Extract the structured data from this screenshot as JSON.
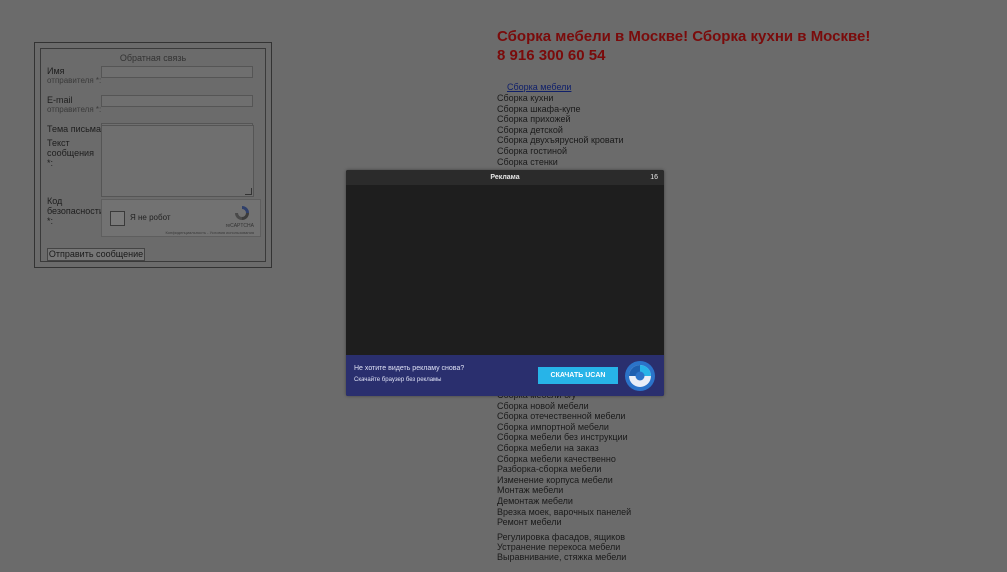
{
  "form": {
    "legend": "Обратная связь",
    "name_label": "Имя",
    "name_req": "отправителя *:",
    "email_label": "E-mail",
    "email_req": "отправителя *:",
    "subject_label": "Тема письма:",
    "message_label": "Текст сообщения *:",
    "captcha_label": "Код безопасности *:",
    "captcha_checkbox": "Я не робот",
    "captcha_brand": "reCAPTCHA",
    "captcha_links": "Конфиденциальность - Условия использования",
    "submit": "Отправить сообщение"
  },
  "page": {
    "title": "Сборка мебели в Москве! Сборка кухни в Москве!",
    "phone": "8 916 300 60 54",
    "menu_link": "Сборка мебели",
    "menu_items": [
      "Сборка кухни",
      "Сборка шкафа-купе",
      "Сборка прихожей",
      "Сборка детской",
      "Сборка двухъярусной кровати",
      "Сборка гостиной",
      "Сборка стенки"
    ],
    "menu_items2": [
      "Сборка мебели б/у",
      "Сборка новой мебели",
      "Сборка отечественной мебели",
      "Сборка импортной мебели",
      "Сборка мебели без инструкции",
      "Сборка мебели на заказ",
      "Сборка мебели качественно",
      "Разборка-сборка мебели",
      "Изменение корпуса мебели",
      "Монтаж мебели",
      "Демонтаж мебели",
      "Врезка моек, варочных панелей",
      "Ремонт мебели"
    ],
    "menu_items3": [
      "Регулировка фасадов, ящиков",
      "Устранение перекоса мебели",
      "Выравнивание, стяжка мебели"
    ]
  },
  "ad": {
    "header": "Реклама",
    "timer": "16",
    "question": "Не хотите видеть рекламу снова?",
    "subtitle": "Скачайте браузер без рекламы",
    "button": "СКАЧАТЬ UCAN",
    "accent_color": "#27b4e8",
    "banner_color": "#2a2f6e"
  }
}
